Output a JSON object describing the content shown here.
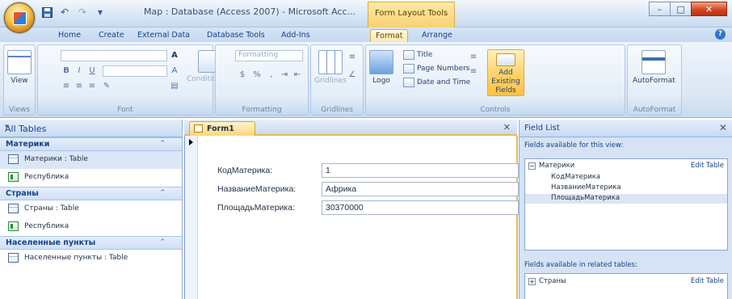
{
  "window": {
    "title": "Map : Database (Access 2007) - Microsoft Acc...",
    "contextual_tab": "Form Layout Tools",
    "colors": {
      "accent": "#f0b94b",
      "ribbon": "#dbe7f5",
      "frame": "#8db2e3"
    }
  },
  "quick_access": {
    "icons": [
      "save-icon",
      "undo-icon",
      "redo-icon",
      "customize-icon"
    ]
  },
  "ribbon_tabs": [
    "Home",
    "Create",
    "External Data",
    "Database Tools",
    "Add-Ins",
    "Format",
    "Arrange"
  ],
  "active_tab": "Format",
  "ribbon": {
    "views": {
      "label": "Views",
      "view_button": "View"
    },
    "font": {
      "label": "Font",
      "bold": "B",
      "italic": "I",
      "underline": "U",
      "conditional": "Conditional"
    },
    "formatting": {
      "label": "Formatting",
      "format_box": "Formatting",
      "percent": "%"
    },
    "gridlines": {
      "label": "Gridlines",
      "button": "Gridlines"
    },
    "controls": {
      "label": "Controls",
      "logo": "Logo",
      "title": "Title",
      "page_numbers": "Page Numbers",
      "date_time": "Date and Time"
    },
    "add_fields": "Add Existing Fields",
    "autoformat": {
      "label": "AutoFormat",
      "button": "AutoFormat"
    }
  },
  "nav_pane": {
    "header": "All Tables",
    "groups": [
      {
        "name": "Материки",
        "items": [
          {
            "label": "Материки : Table",
            "type": "table",
            "selected": true
          },
          {
            "label": "Республика",
            "type": "form",
            "selected": false
          }
        ]
      },
      {
        "name": "Страны",
        "items": [
          {
            "label": "Страны : Table",
            "type": "table",
            "selected": false
          },
          {
            "label": "Республика",
            "type": "form",
            "selected": false
          }
        ]
      },
      {
        "name": "Населенные пункты",
        "items": [
          {
            "label": "Населенные пункты : Table",
            "type": "table",
            "selected": false
          }
        ]
      }
    ]
  },
  "document": {
    "tab_label": "Form1",
    "fields": [
      {
        "label": "КодМатерика:",
        "value": "1"
      },
      {
        "label": "НазваниеМатерика:",
        "value": "Африка"
      },
      {
        "label": "ПлощадьМатерика:",
        "value": "30370000"
      }
    ]
  },
  "field_list": {
    "header": "Field List",
    "available_caption": "Fields available for this view:",
    "table_name": "Материки",
    "edit_table": "Edit Table",
    "fields": [
      "КодМатерика",
      "НазваниеМатерика",
      "ПлощадьМатерика"
    ],
    "highlighted_field": "ПлощадьМатерика",
    "related_caption": "Fields available in related tables:",
    "related_table": "Страны",
    "related_edit_table": "Edit Table"
  }
}
